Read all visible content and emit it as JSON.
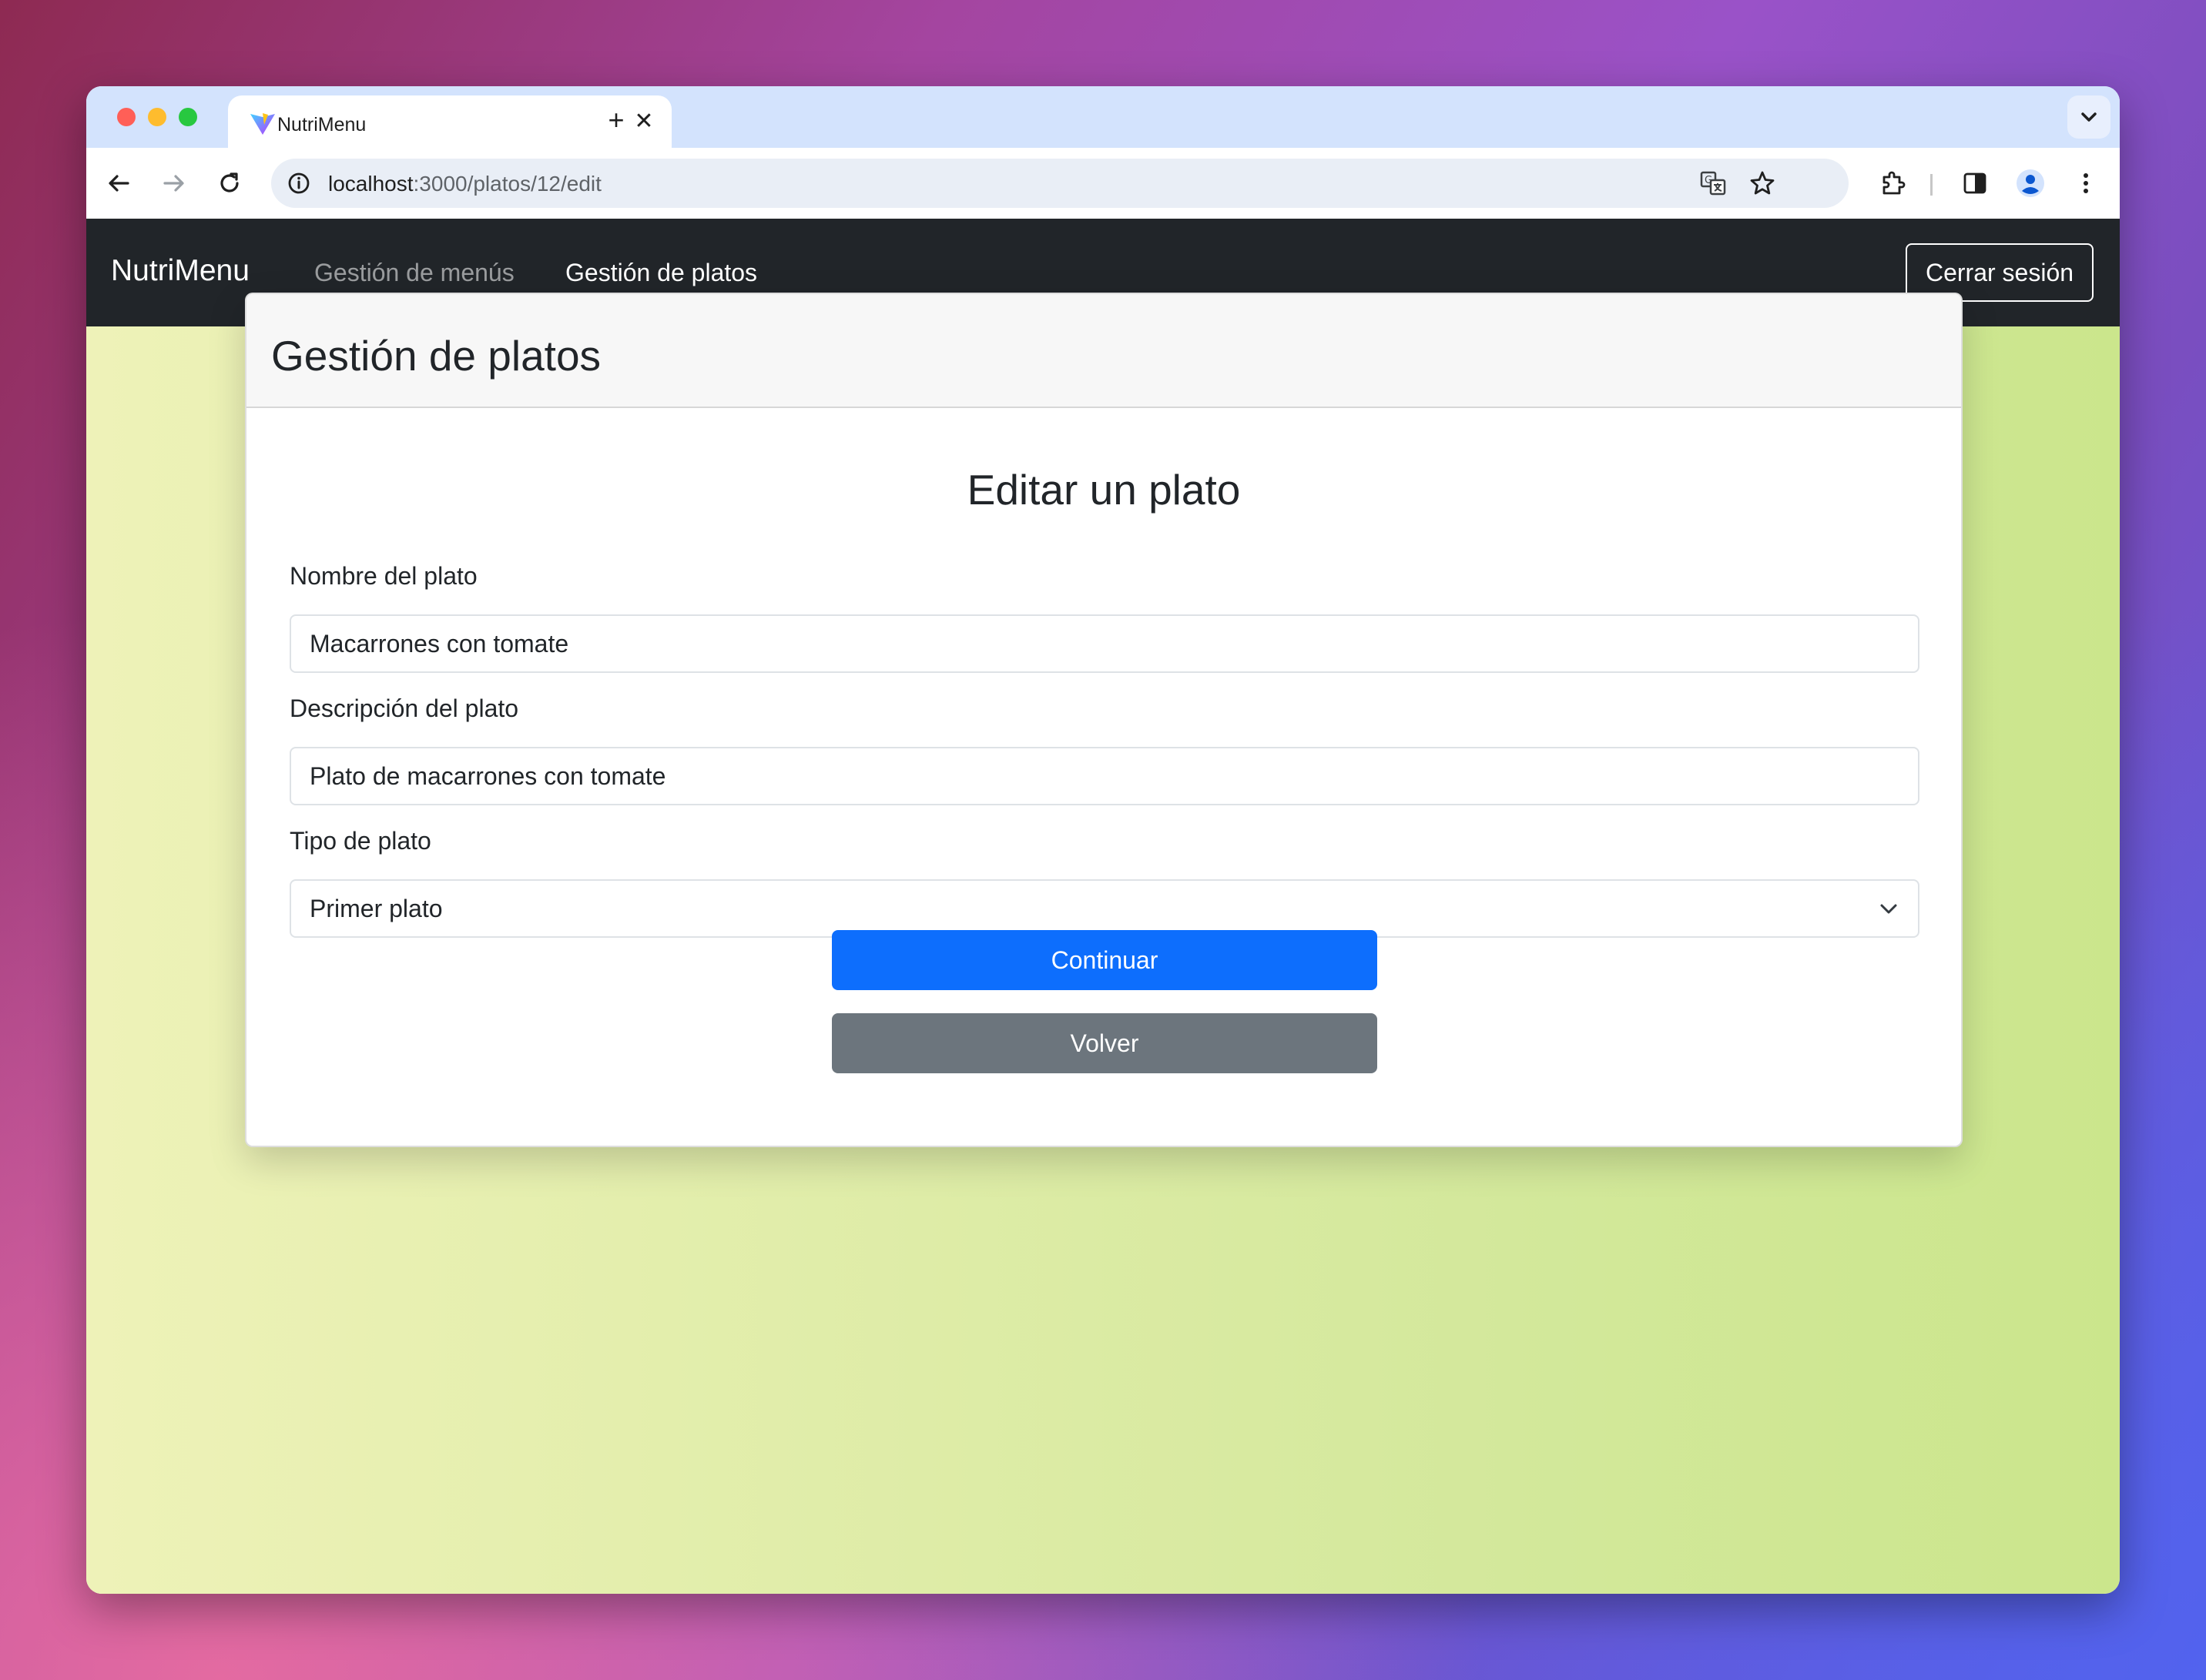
{
  "browser": {
    "tab_title": "NutriMenu",
    "tab_close": "✕",
    "new_tab": "+",
    "url_host": "localhost",
    "url_path": ":3000/platos/12/edit"
  },
  "navbar": {
    "brand": "NutriMenu",
    "links": [
      {
        "label": "Gestión de menús",
        "active": false
      },
      {
        "label": "Gestión de platos",
        "active": true
      }
    ],
    "logout_label": "Cerrar sesión"
  },
  "card": {
    "header_title": "Gestión de platos",
    "form_title": "Editar un plato",
    "fields": {
      "name": {
        "label": "Nombre del plato",
        "value": "Macarrones con tomate"
      },
      "description": {
        "label": "Descripción del plato",
        "value": "Plato de macarrones con tomate"
      },
      "type": {
        "label": "Tipo de plato",
        "value": "Primer plato"
      }
    },
    "continue_label": "Continuar",
    "back_label": "Volver"
  },
  "colors": {
    "navbar_bg": "#212529",
    "primary": "#0d6efd",
    "secondary": "#6c757d"
  },
  "icons": [
    "back-arrow-icon",
    "forward-arrow-icon",
    "reload-icon",
    "info-icon",
    "translate-icon",
    "star-icon",
    "extensions-icon",
    "side-panel-icon",
    "profile-icon",
    "more-menu-icon",
    "chevron-down-icon"
  ]
}
